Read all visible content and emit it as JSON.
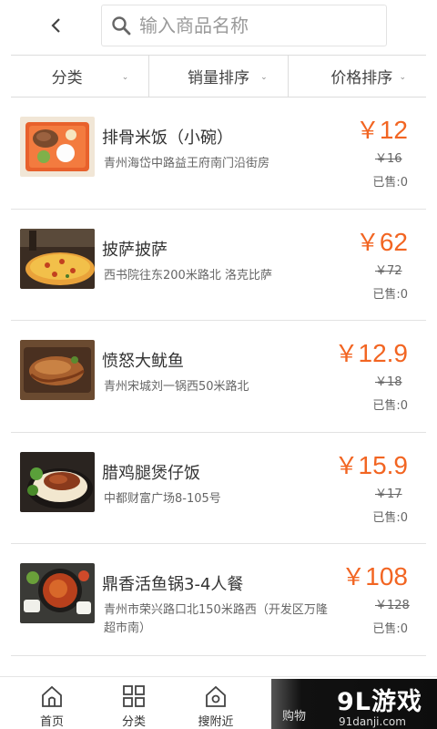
{
  "header": {
    "search_placeholder": "输入商品名称"
  },
  "filters": [
    {
      "label": "分类"
    },
    {
      "label": "销量排序"
    },
    {
      "label": "价格排序"
    }
  ],
  "currency": "￥",
  "products": [
    {
      "name": "排骨米饭（小碗）",
      "address": "青州海岱中路益王府南门沿街房",
      "price": "12",
      "old_price": "￥16",
      "sold": "已售:0"
    },
    {
      "name": "披萨披萨",
      "address": "西书院往东200米路北 洛克比萨",
      "price": "62",
      "old_price": "￥72",
      "sold": "已售:0"
    },
    {
      "name": "愤怒大鱿鱼",
      "address": "青州宋城刘一锅西50米路北",
      "price": "12.9",
      "old_price": "￥18",
      "sold": "已售:0"
    },
    {
      "name": "腊鸡腿煲仔饭",
      "address": "中都财富广场8-105号",
      "price": "15.9",
      "old_price": "￥17",
      "sold": "已售:0"
    },
    {
      "name": "鼎香活鱼锅3-4人餐",
      "address": "青州市荣兴路口北150米路西（开发区万隆超市南）",
      "price": "108",
      "old_price": "￥128",
      "sold": "已售:0"
    }
  ],
  "bottom_nav": {
    "home": "首页",
    "category": "分类",
    "nearby": "搜附近",
    "cart": "购物"
  },
  "watermark": {
    "logo": "9L游戏",
    "url": "91danji.com"
  },
  "colors": {
    "price": "#f26522",
    "text": "#333333",
    "muted": "#666666",
    "divider": "#e2e2e2"
  }
}
